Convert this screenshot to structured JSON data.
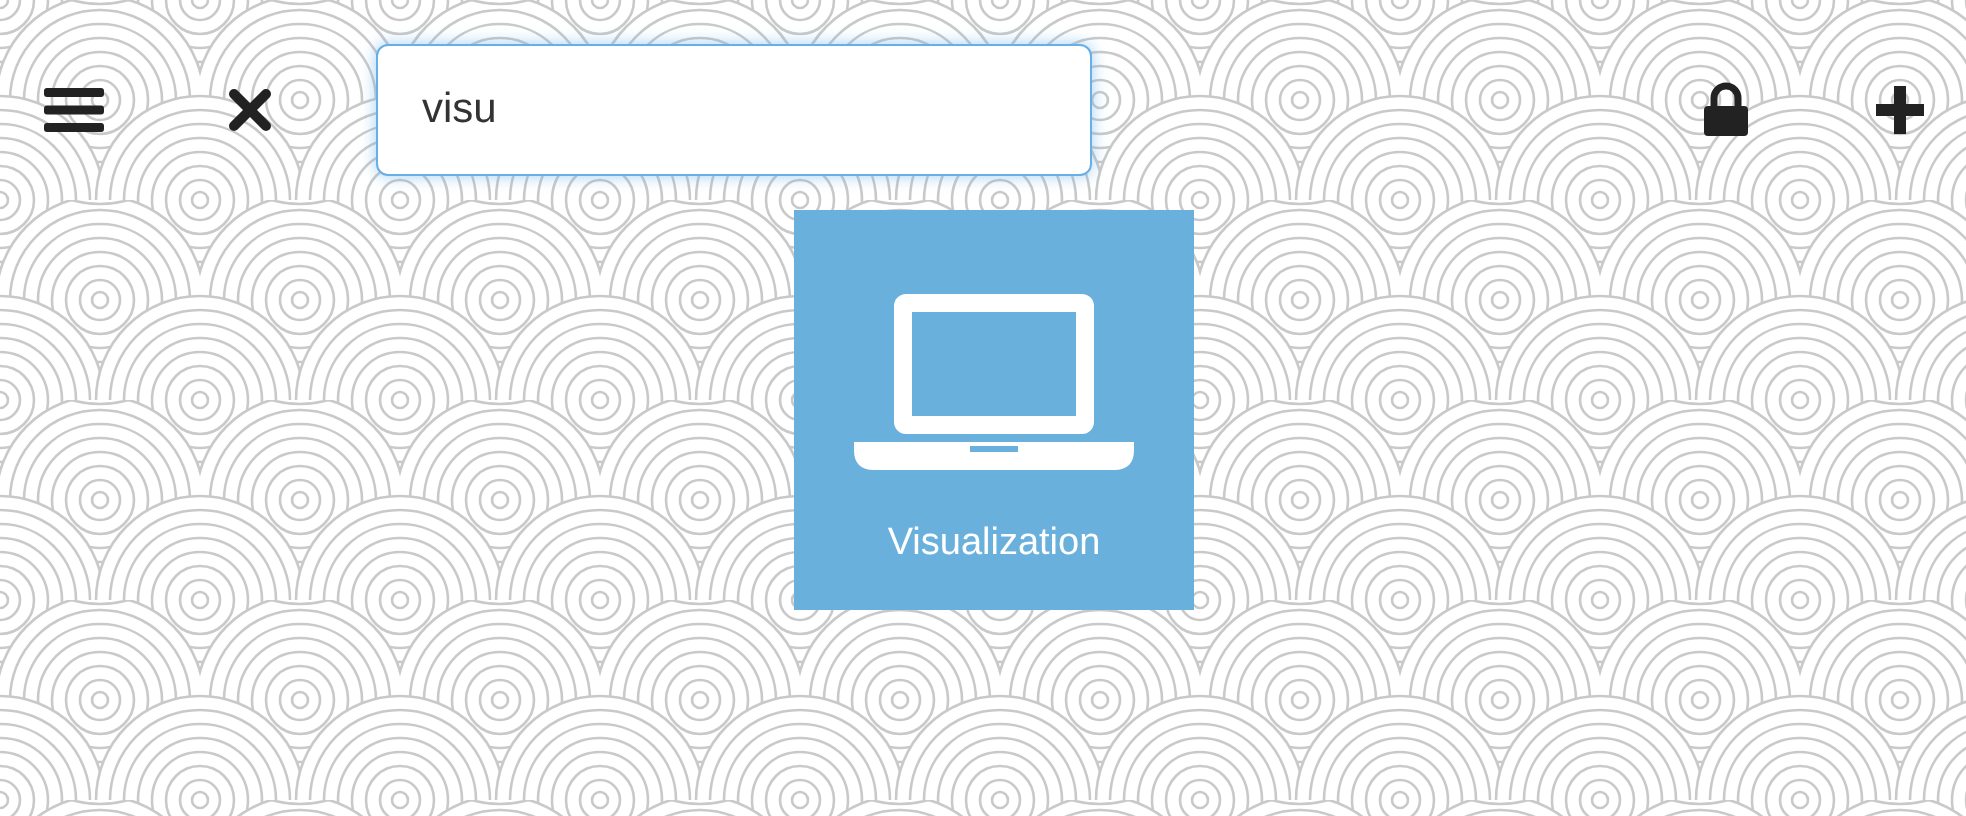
{
  "search": {
    "value": "visu"
  },
  "tiles": [
    {
      "label": "Visualization"
    }
  ]
}
